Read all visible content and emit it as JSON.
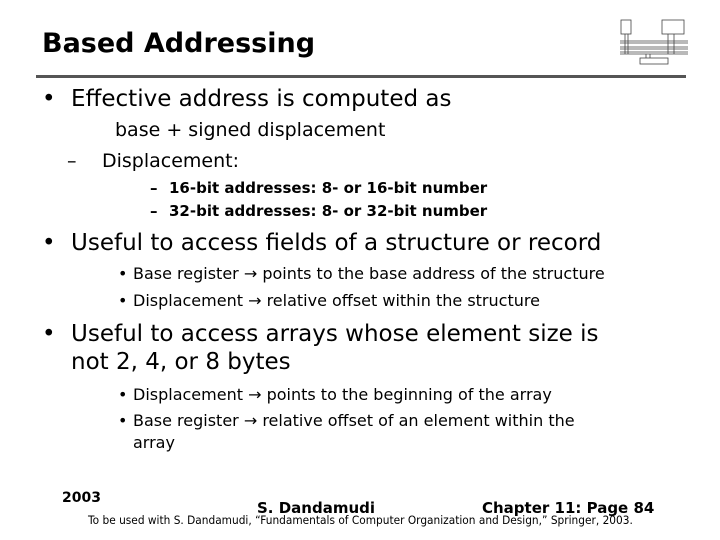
{
  "title": "Based Addressing",
  "bullets": {
    "b1": "Effective address is computed as",
    "b1_formula": "base + signed displacement",
    "b1_sub": "Displacement:",
    "b1_sub_items": [
      "16-bit addresses: 8- or 16-bit number",
      "32-bit addresses: 8- or 32-bit number"
    ],
    "b2": "Useful to access fields of a structure or record",
    "b2_items": [
      "Base register → points to the base address of the structure",
      "Displacement → relative offset within the structure"
    ],
    "b3_line1": "Useful to access arrays whose element size is",
    "b3_line2": "not 2, 4, or 8 bytes",
    "b3_items": [
      "Displacement → points to the beginning of the array",
      "Base register → relative offset of an element within the",
      "array"
    ]
  },
  "marks": {
    "bullet": "•",
    "dash": "–"
  },
  "footer": {
    "year": "2003",
    "author": "S. Dandamudi",
    "page": "Chapter 11: Page 84",
    "credit": "To be used with S. Dandamudi, “Fundamentals of Computer Organization and Design,” Springer, 2003."
  },
  "logo": "computer-bus-diagram-icon"
}
